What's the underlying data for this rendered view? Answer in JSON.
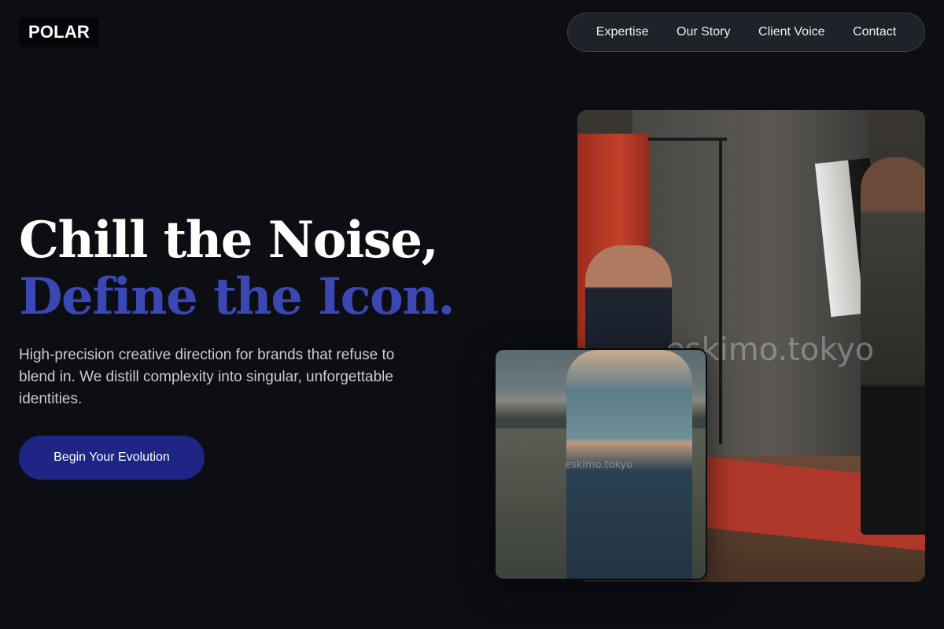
{
  "brand": {
    "logo": "POLAR"
  },
  "nav": {
    "items": [
      {
        "label": "Expertise"
      },
      {
        "label": "Our Story"
      },
      {
        "label": "Client Voice"
      },
      {
        "label": "Contact"
      }
    ]
  },
  "hero": {
    "headline_line1": "Chill the Noise,",
    "headline_line2": "Define the Icon.",
    "lead": "High-precision creative direction for brands that refuse to blend in. We distill complexity into singular, unforgettable identities.",
    "cta_label": "Begin Your Evolution"
  },
  "images": {
    "main_watermark": "eskimo.tokyo",
    "small_watermark": "eskimo.tokyo"
  },
  "colors": {
    "background": "#0c0e13",
    "accent": "#3b47b3",
    "cta_background": "#1d2585"
  }
}
